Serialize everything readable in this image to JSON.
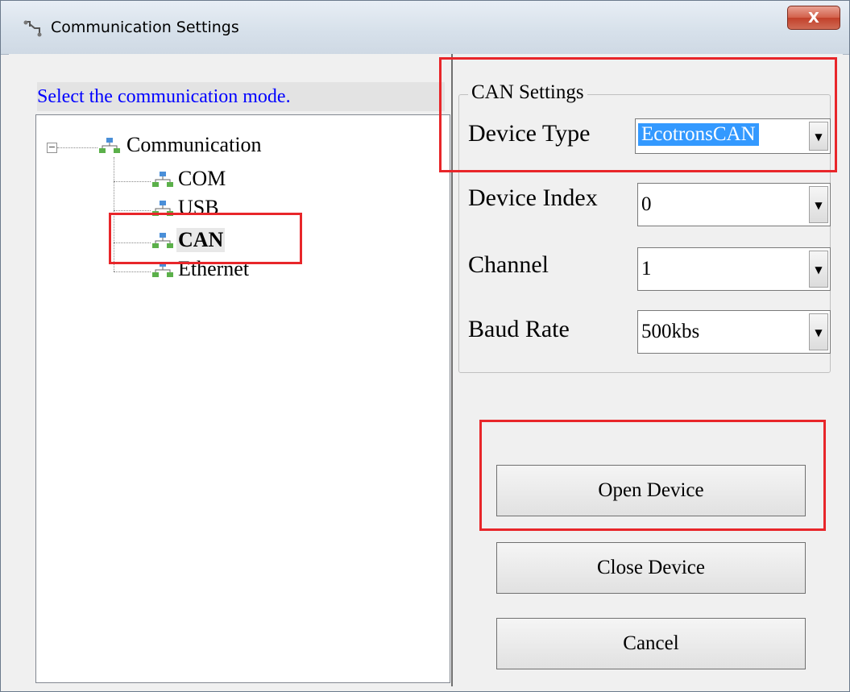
{
  "window": {
    "title": "Communication Settings",
    "close_label": "X"
  },
  "left": {
    "mode_label": "Select the communication mode.",
    "tree": {
      "root": "Communication",
      "items": [
        "COM",
        "USB",
        "CAN",
        "Ethernet"
      ],
      "selected": "CAN"
    }
  },
  "can_settings": {
    "group_title": "CAN Settings",
    "device_type": {
      "label": "Device Type",
      "value": "EcotronsCAN"
    },
    "device_index": {
      "label": "Device Index",
      "value": "0"
    },
    "channel": {
      "label": "Channel",
      "value": "1"
    },
    "baud_rate": {
      "label": "Baud Rate",
      "value": "500kbs"
    }
  },
  "buttons": {
    "open": "Open Device",
    "close": "Close Device",
    "cancel": "Cancel"
  },
  "colors": {
    "highlight": "#e8262a",
    "selection": "#3399ff",
    "link_text": "#0000ff"
  }
}
